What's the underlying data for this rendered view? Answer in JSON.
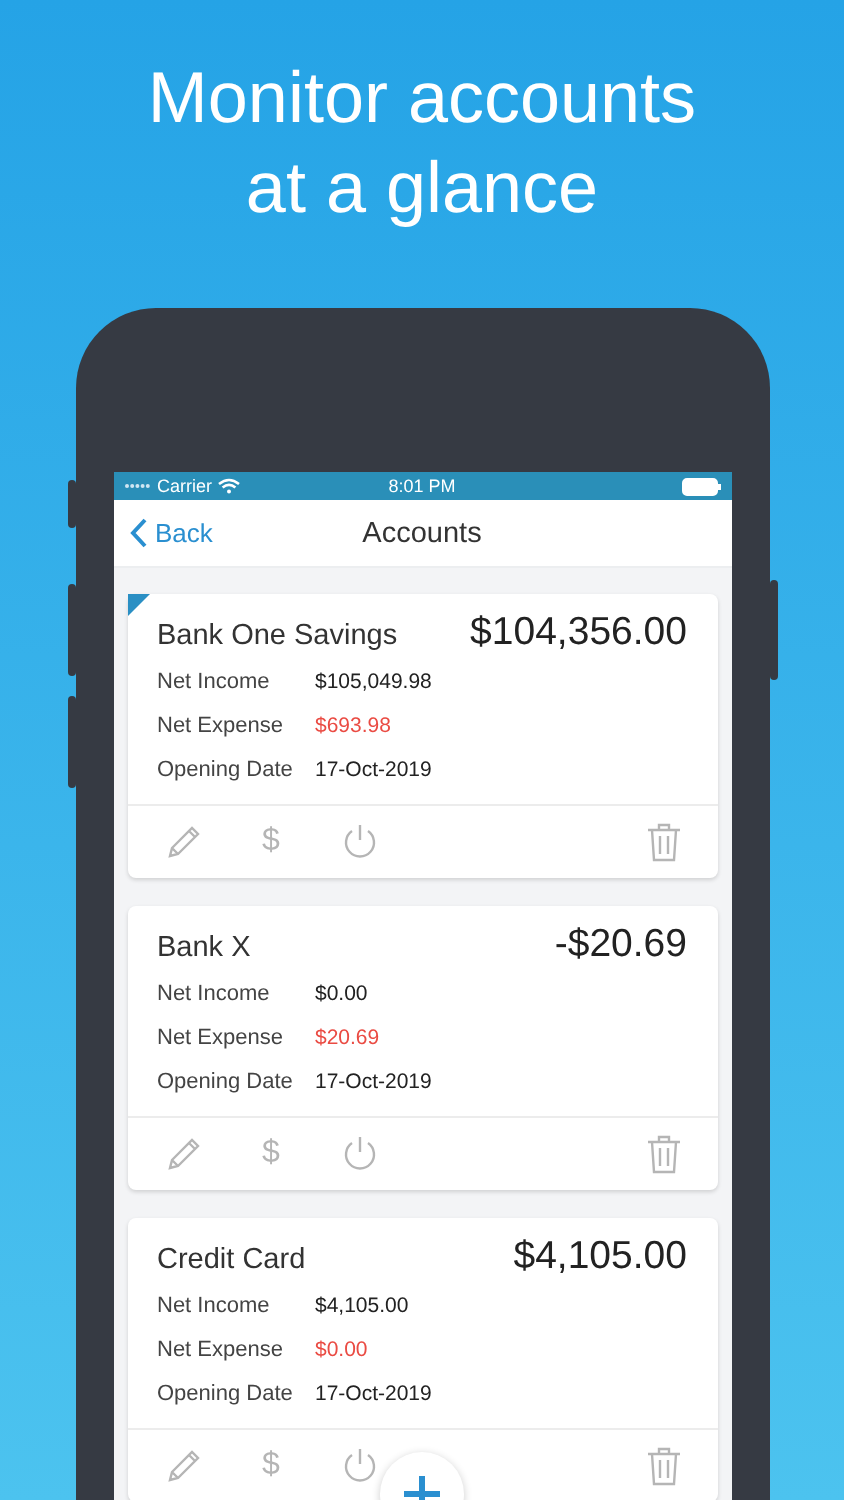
{
  "headline": "Monitor accounts at a glance",
  "status_bar": {
    "carrier": "Carrier",
    "time": "8:01 PM"
  },
  "nav": {
    "back": "Back",
    "title": "Accounts"
  },
  "accounts": [
    {
      "name": "Bank One Savings",
      "balance": "$104,356.00",
      "flagged": true,
      "money_symbol": "$",
      "rows": [
        {
          "label": "Net Income",
          "value": "$105,049.98",
          "kind": "plain"
        },
        {
          "label": "Net Expense",
          "value": "$693.98",
          "kind": "expense"
        },
        {
          "label": "Opening Date",
          "value": "17-Oct-2019",
          "kind": "plain"
        }
      ]
    },
    {
      "name": "Bank X",
      "balance": "-$20.69",
      "flagged": false,
      "money_symbol": "$",
      "rows": [
        {
          "label": "Net Income",
          "value": "$0.00",
          "kind": "plain"
        },
        {
          "label": "Net Expense",
          "value": "$20.69",
          "kind": "expense"
        },
        {
          "label": "Opening Date",
          "value": "17-Oct-2019",
          "kind": "plain"
        }
      ]
    },
    {
      "name": "Credit Card",
      "balance": "$4,105.00",
      "flagged": false,
      "money_symbol": "$",
      "rows": [
        {
          "label": "Net Income",
          "value": "$4,105.00",
          "kind": "plain"
        },
        {
          "label": "Net Expense",
          "value": "$0.00",
          "kind": "expense"
        },
        {
          "label": "Opening Date",
          "value": "17-Oct-2019",
          "kind": "plain"
        }
      ]
    }
  ]
}
